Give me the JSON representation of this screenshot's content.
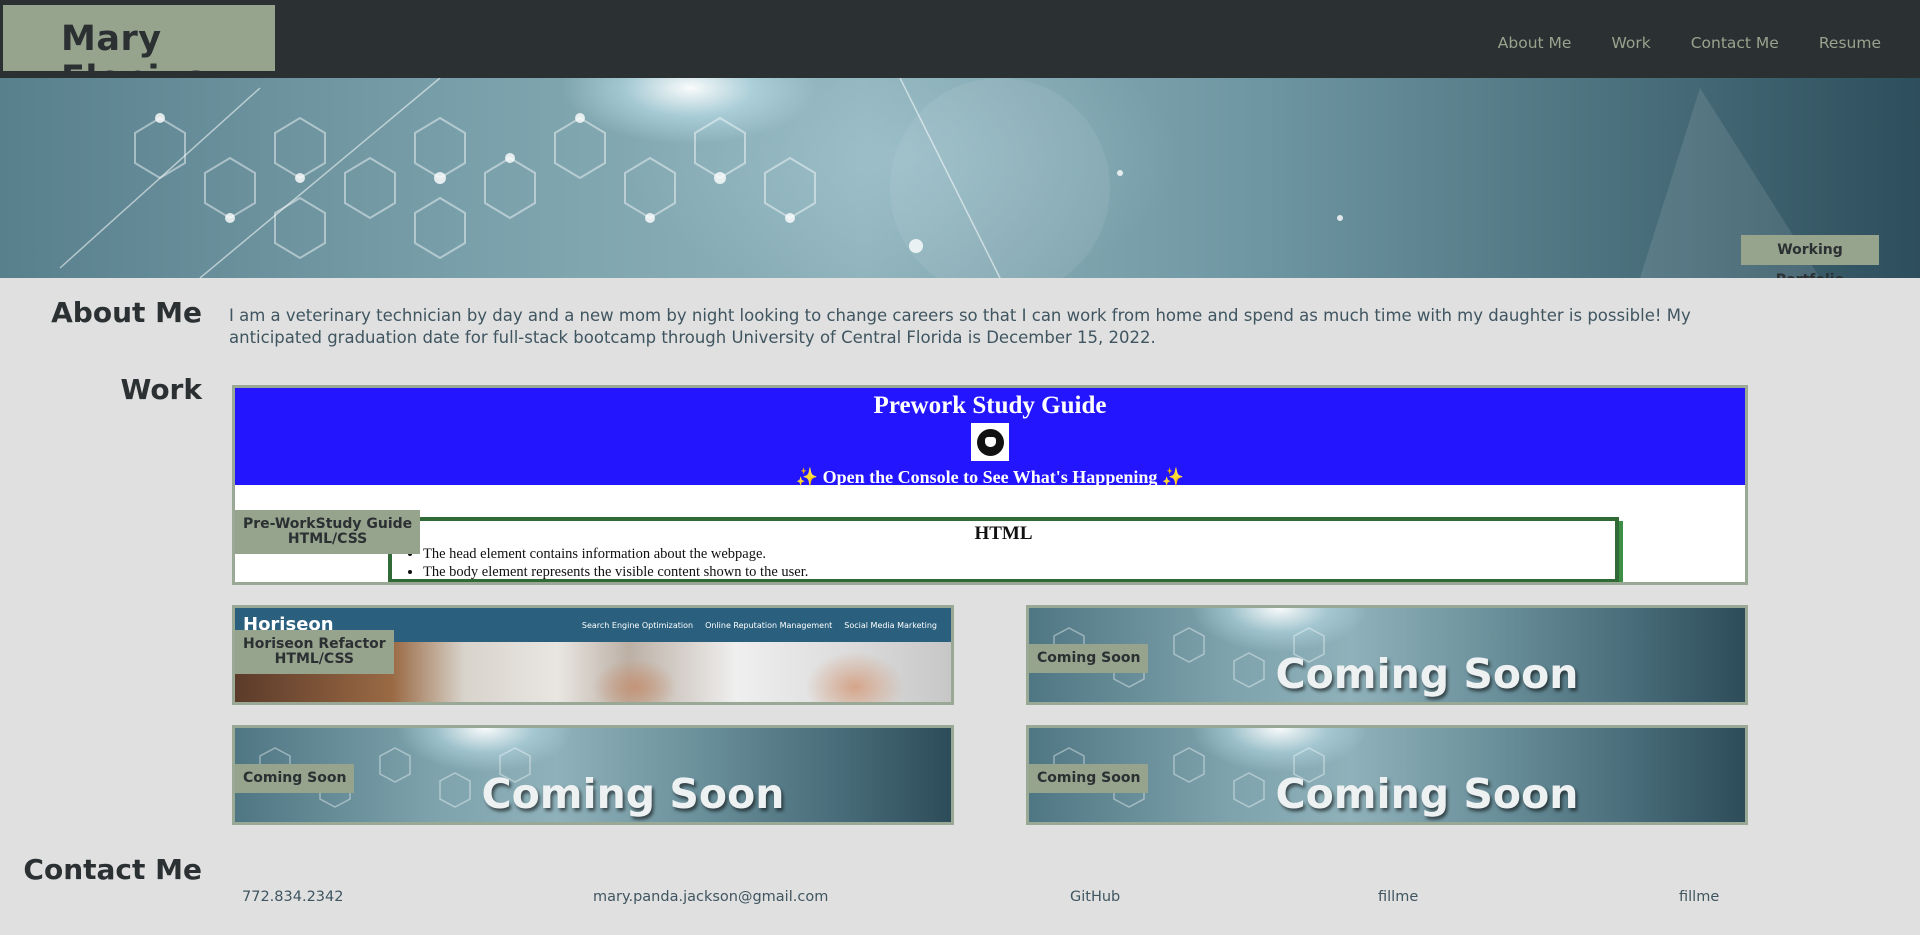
{
  "header": {
    "brand": "Mary Elenius",
    "nav": [
      "About Me",
      "Work",
      "Contact Me",
      "Resume"
    ]
  },
  "hero": {
    "badge": "Working Portfolio"
  },
  "about": {
    "title": "About Me",
    "text": "I am a veterinary technician by day and a new mom by night looking to change careers so that I can work from home and spend as much time with my daughter is possible! My anticipated graduation date for full-stack bootcamp through University of Central Florida is December 15, 2022."
  },
  "work": {
    "title": "Work",
    "prework": {
      "title": "Prework Study Guide",
      "subtitle": "✨ Open the Console to See What's Happening ✨",
      "box_title": "HTML",
      "bullets": [
        "The head element contains information about the webpage.",
        "The body element represents the visible content shown to the user."
      ],
      "label_line1": "Pre-WorkStudy Guide",
      "label_line2": "HTML/CSS"
    },
    "horiseon": {
      "logo": "Horiseon",
      "nav": [
        "Search Engine Optimization",
        "Online Reputation Management",
        "Social Media Marketing"
      ],
      "label_line1": "Horiseon Refactor",
      "label_line2": "HTML/CSS"
    },
    "coming": [
      {
        "label": "Coming Soon",
        "image_text": "Coming Soon"
      },
      {
        "label": "Coming Soon",
        "image_text": "Coming Soon"
      },
      {
        "label": "Coming Soon",
        "image_text": "Coming Soon"
      }
    ]
  },
  "contact": {
    "title": "Contact Me",
    "items": [
      "772.834.2342",
      "mary.panda.jackson@gmail.com",
      "GitHub",
      "fillme",
      "fillme"
    ]
  },
  "colors": {
    "header_bg": "#2b3033",
    "accent": "#96a38d",
    "page_bg": "#e0e0e0",
    "prework_blue": "#2415ff"
  }
}
